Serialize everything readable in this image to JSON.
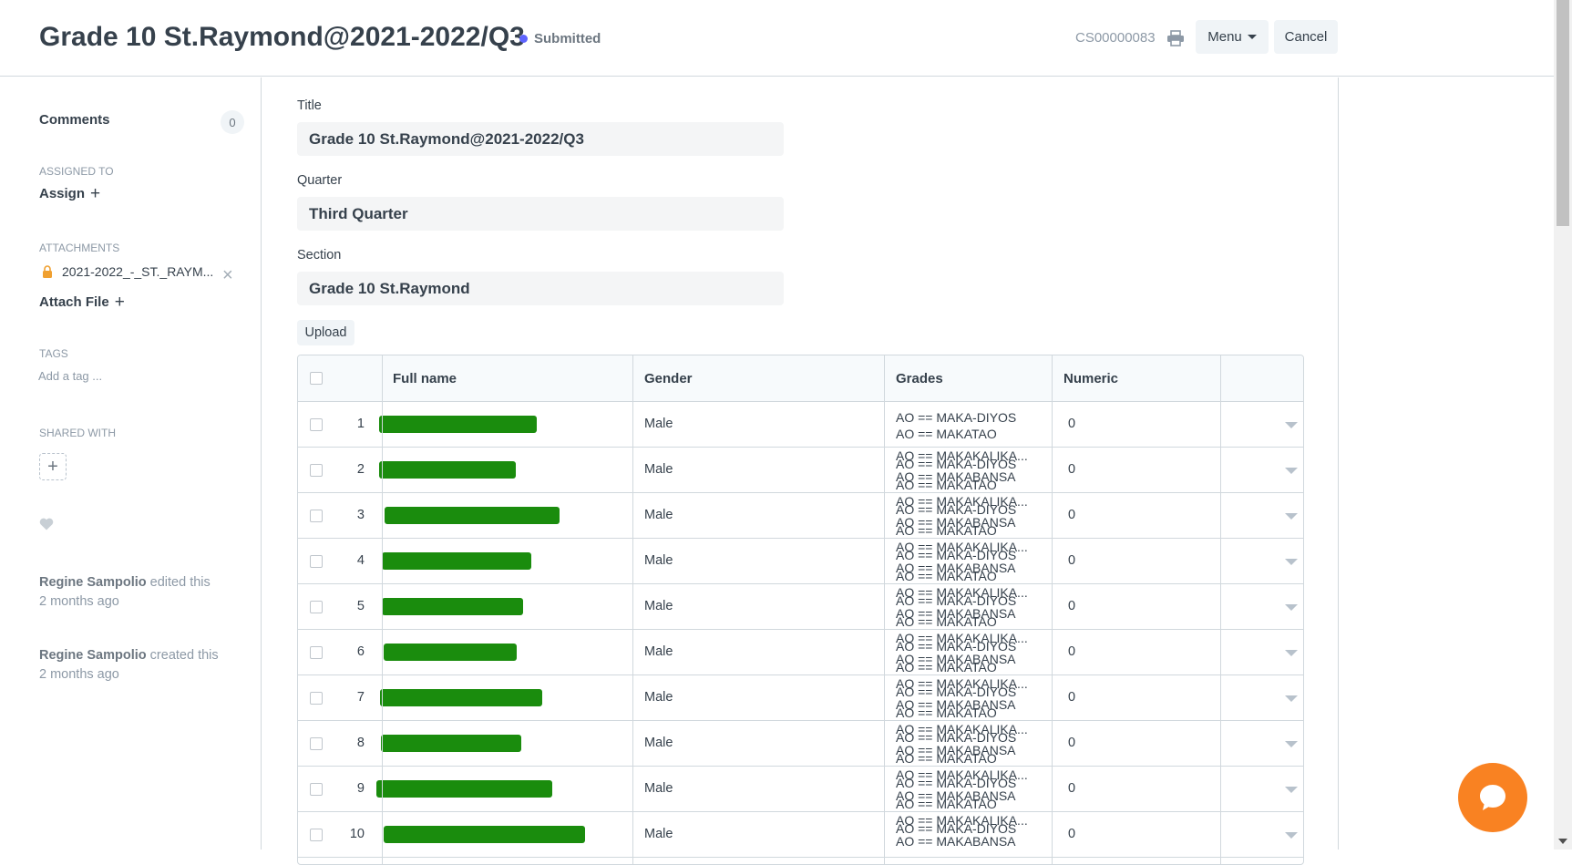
{
  "header": {
    "title": "Grade 10 St.Raymond@2021-2022/Q3",
    "status": "Submitted",
    "doc_name": "CS00000083",
    "menu_label": "Menu",
    "cancel_label": "Cancel",
    "status_color": "#5e64ff"
  },
  "sidebar": {
    "comments_label": "Comments",
    "comments_count": "0",
    "assigned_to_label": "ASSIGNED TO",
    "assign_label": "Assign",
    "attachments_label": "ATTACHMENTS",
    "attachment_file": "2021-2022_-_ST._RAYM...",
    "attach_file_label": "Attach File",
    "tags_label": "TAGS",
    "add_tag_placeholder": "Add a tag ...",
    "shared_with_label": "SHARED WITH",
    "activity": [
      {
        "user": "Regine Sampolio",
        "action": "edited this",
        "when": "2 months ago"
      },
      {
        "user": "Regine Sampolio",
        "action": "created this",
        "when": "2 months ago"
      }
    ]
  },
  "form": {
    "title_label": "Title",
    "title_value": "Grade 10 St.Raymond@2021-2022/Q3",
    "quarter_label": "Quarter",
    "quarter_value": "Third Quarter",
    "section_label": "Section",
    "section_value": "Grade 10 St.Raymond",
    "upload_label": "Upload"
  },
  "table": {
    "headers": {
      "full_name": "Full name",
      "gender": "Gender",
      "grades": "Grades",
      "numeric": "Numeric"
    },
    "rows": [
      {
        "idx": "1",
        "gender": "Male",
        "numeric": "0",
        "grades": [
          "AO == MAKA-DIYOS",
          "AO == MAKATAO"
        ]
      },
      {
        "idx": "2",
        "gender": "Male",
        "numeric": "0",
        "grades": [
          "AO == MAKAKALIKA...",
          "AO == MAKA-DIYOS",
          "AO == MAKABANSA",
          "AO == MAKATAO"
        ]
      },
      {
        "idx": "3",
        "gender": "Male",
        "numeric": "0",
        "grades": [
          "AO == MAKAKALIKA...",
          "AO == MAKA-DIYOS",
          "AO == MAKABANSA",
          "AO == MAKATAO"
        ]
      },
      {
        "idx": "4",
        "gender": "Male",
        "numeric": "0",
        "grades": [
          "AO == MAKAKALIKA...",
          "AO == MAKA-DIYOS",
          "AO == MAKABANSA",
          "AO == MAKATAO"
        ]
      },
      {
        "idx": "5",
        "gender": "Male",
        "numeric": "0",
        "grades": [
          "AO == MAKAKALIKA...",
          "AO == MAKA-DIYOS",
          "AO == MAKABANSA",
          "AO == MAKATAO"
        ]
      },
      {
        "idx": "6",
        "gender": "Male",
        "numeric": "0",
        "grades": [
          "AO == MAKAKALIKA...",
          "AO == MAKA-DIYOS",
          "AO == MAKABANSA",
          "AO == MAKATAO"
        ]
      },
      {
        "idx": "7",
        "gender": "Male",
        "numeric": "0",
        "grades": [
          "AO == MAKAKALIKA...",
          "AO == MAKA-DIYOS",
          "AO == MAKABANSA",
          "AO == MAKATAO"
        ]
      },
      {
        "idx": "8",
        "gender": "Male",
        "numeric": "0",
        "grades": [
          "AO == MAKAKALIKA...",
          "AO == MAKA-DIYOS",
          "AO == MAKABANSA",
          "AO == MAKATAO"
        ]
      },
      {
        "idx": "9",
        "gender": "Male",
        "numeric": "0",
        "grades": [
          "AO == MAKAKALIKA...",
          "AO == MAKA-DIYOS",
          "AO == MAKABANSA",
          "AO == MAKATAO"
        ]
      },
      {
        "idx": "10",
        "gender": "Male",
        "numeric": "0",
        "grades": [
          "AO == MAKAKALIKA...",
          "AO == MAKA-DIYOS",
          "AO == MAKABANSA"
        ]
      }
    ]
  },
  "colors": {
    "accent": "#5e64ff",
    "redaction": "#1a8c0d",
    "chat_bubble": "#f98222"
  },
  "icons": {
    "print": "printer-icon",
    "lock": "lock-icon",
    "heart": "heart-icon",
    "chat": "chat-icon"
  }
}
